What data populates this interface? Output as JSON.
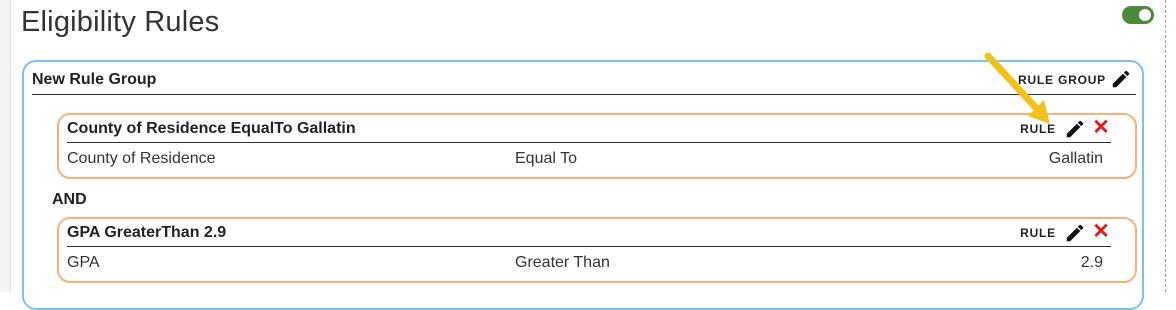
{
  "page": {
    "title": "Eligibility Rules",
    "toggle_on": true
  },
  "colors": {
    "group_border": "#7cc1ec",
    "rule_border": "#f3b27a",
    "toggle_on": "#4b8a3c",
    "delete": "#e31b1b",
    "arrow": "#f2c21a"
  },
  "group": {
    "title": "New Rule Group",
    "type_label": "RULE GROUP",
    "connector": "AND",
    "rules": [
      {
        "title": "County of Residence EqualTo Gallatin",
        "type_label": "RULE",
        "field": "County of Residence",
        "operator": "Equal To",
        "value": "Gallatin"
      },
      {
        "title": "GPA GreaterThan 2.9",
        "type_label": "RULE",
        "field": "GPA",
        "operator": "Greater Than",
        "value": "2.9"
      }
    ]
  },
  "icons": {
    "edit": "pencil-icon",
    "delete": "close-icon",
    "toggle": "toggle-switch",
    "pointer": "arrow-icon"
  }
}
